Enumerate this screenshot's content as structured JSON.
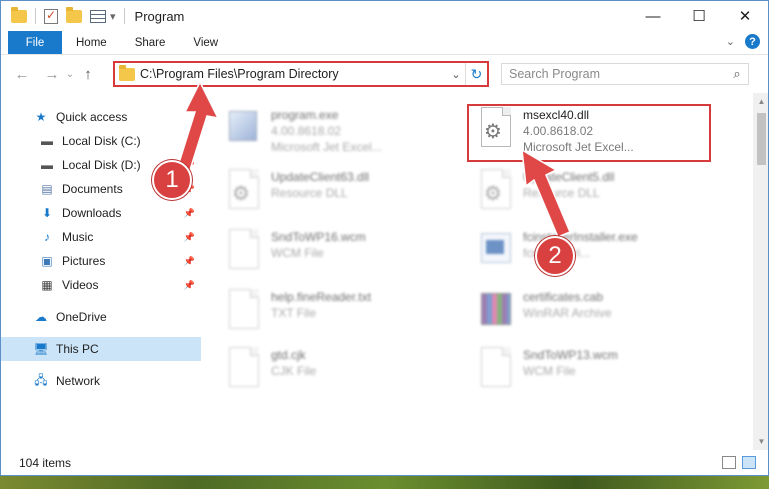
{
  "window": {
    "title": "Program",
    "controls": {
      "minimize": "—",
      "maximize": "☐",
      "close": "✕"
    }
  },
  "ribbon": {
    "tabs": [
      "File",
      "Home",
      "Share",
      "View"
    ]
  },
  "navigation": {
    "address_path": "C:\\Program Files\\Program Directory",
    "search_placeholder": "Search Program"
  },
  "sidebar": {
    "items": [
      {
        "label": "Quick access",
        "icon": "star-icon"
      },
      {
        "label": "Local Disk (C:)",
        "icon": "drive-icon",
        "pinned": true
      },
      {
        "label": "Local Disk (D:)",
        "icon": "drive-icon",
        "pinned": true
      },
      {
        "label": "Documents",
        "icon": "documents-icon",
        "pinned": true
      },
      {
        "label": "Downloads",
        "icon": "download-icon",
        "pinned": true
      },
      {
        "label": "Music",
        "icon": "music-icon",
        "pinned": true
      },
      {
        "label": "Pictures",
        "icon": "pictures-icon",
        "pinned": true
      },
      {
        "label": "Videos",
        "icon": "videos-icon",
        "pinned": true
      },
      {
        "label": "OneDrive",
        "icon": "cloud-icon"
      },
      {
        "label": "This PC",
        "icon": "computer-icon",
        "selected": true
      },
      {
        "label": "Network",
        "icon": "network-icon"
      }
    ]
  },
  "files": [
    {
      "name": "program.exe",
      "line1": "4.00.8618.02",
      "line2": "Microsoft Jet Excel...",
      "icon": "program-icon"
    },
    {
      "name": "msexcl40.dll",
      "line1": "4.00.8618.02",
      "line2": "Microsoft Jet Excel...",
      "icon": "dll-gear-icon"
    },
    {
      "name": "UpdateClient63.dll",
      "line1": "Resource DLL",
      "line2": "",
      "icon": "dll-gear-icon"
    },
    {
      "name": "UpdateClient5.dll",
      "line1": "Resource DLL",
      "line2": "",
      "icon": "dll-gear-icon"
    },
    {
      "name": "SndToWP16.wcm",
      "line1": "WCM File",
      "line2": "",
      "icon": "document-icon"
    },
    {
      "name": "fcinstallerInstaller.exe",
      "line1": "fcreader tri...",
      "line2": "",
      "icon": "exe-icon"
    },
    {
      "name": "help.fineReader.txt",
      "line1": "TXT File",
      "line2": "",
      "icon": "document-icon"
    },
    {
      "name": "certificates.cab",
      "line1": "WinRAR Archive",
      "line2": "",
      "icon": "archive-icon"
    },
    {
      "name": "gtd.cjk",
      "line1": "CJK File",
      "line2": "",
      "icon": "document-icon"
    },
    {
      "name": "SndToWP13.wcm",
      "line1": "WCM File",
      "line2": "",
      "icon": "document-icon"
    }
  ],
  "status": {
    "items_count": "104 items"
  },
  "annotations": {
    "step1": "1",
    "step2": "2"
  },
  "colors": {
    "accent": "#1979ca",
    "highlight": "#d63a3a",
    "selected": "#cce4f7"
  }
}
